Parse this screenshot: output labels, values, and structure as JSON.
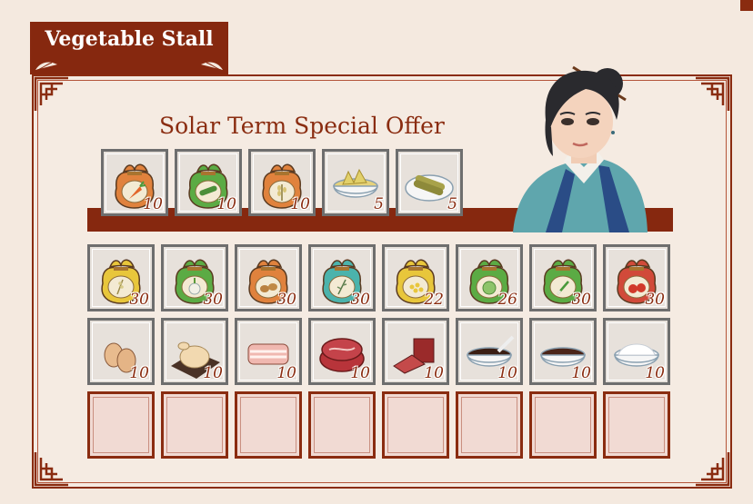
{
  "title": "Vegetable Stall",
  "offer": {
    "title": "Solar Term Special Offer",
    "items": [
      {
        "name": "carrot-seed-bag-icon",
        "count": "10"
      },
      {
        "name": "cucumber-seed-bag-icon",
        "count": "10"
      },
      {
        "name": "wheat-seed-bag-icon",
        "count": "10"
      },
      {
        "name": "bamboo-shoot-bowl-icon",
        "count": "5"
      },
      {
        "name": "pickled-cucumber-plate-icon",
        "count": "5"
      }
    ]
  },
  "shop": {
    "row1": [
      {
        "name": "rice-seed-bag-icon",
        "count": "30"
      },
      {
        "name": "garlic-seed-bag-icon",
        "count": "30"
      },
      {
        "name": "potato-seed-bag-icon",
        "count": "30"
      },
      {
        "name": "rosemary-seed-bag-icon",
        "count": "30"
      },
      {
        "name": "corn-seed-bag-icon",
        "count": "22"
      },
      {
        "name": "cabbage-seed-bag-icon",
        "count": "26"
      },
      {
        "name": "scallion-seed-bag-icon",
        "count": "30"
      },
      {
        "name": "tomato-seed-bag-icon",
        "count": "30"
      }
    ],
    "row2": [
      {
        "name": "eggs-icon",
        "count": "10"
      },
      {
        "name": "chicken-icon",
        "count": "10"
      },
      {
        "name": "pork-belly-icon",
        "count": "10"
      },
      {
        "name": "steak-icon",
        "count": "10"
      },
      {
        "name": "cured-meat-icon",
        "count": "10"
      },
      {
        "name": "soy-sauce-bowl-icon",
        "count": "10"
      },
      {
        "name": "vinegar-bowl-icon",
        "count": "10"
      },
      {
        "name": "salt-bowl-icon",
        "count": "10"
      }
    ],
    "empty_slots": 8
  },
  "colors": {
    "accent": "#86280f",
    "background": "#f4e9df",
    "bag_orange": "#e0823d",
    "bag_green": "#5bab44",
    "bag_yellow": "#e8c63b",
    "bag_teal": "#4bb3ac",
    "bag_red": "#d14a3a"
  }
}
